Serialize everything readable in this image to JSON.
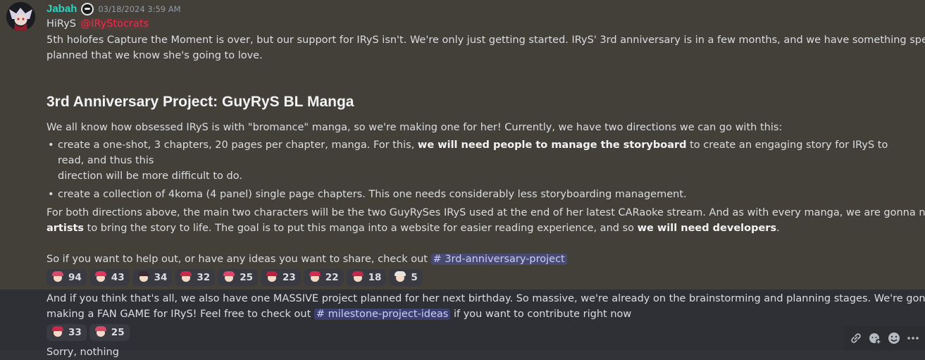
{
  "message1": {
    "username": "Jabah",
    "timestamp": "03/18/2024 3:59 AM",
    "greeting": "HiRyS",
    "mention": "@IRyStocrats",
    "intro": "5th holofes Capture the Moment is over, but our support for IRyS isn't. We're only just getting started. IRyS' 3rd anniversary is in a few months, and we have something special",
    "intro2": "planned that we know she's going to love.",
    "heading": "3rd Anniversary Project: GuyRyS BL Manga",
    "para1": "We all know how obsessed IRyS is with \"bromance\" manga, so we're making one for her! Currently, we have two directions we can go with this:",
    "bullet1_pre": "create a one-shot, 3 chapters, 20 pages per chapter, manga. For this, ",
    "bullet1_bold": "we will need people to manage the storyboard",
    "bullet1_post": " to create an engaging story for IRyS to read, and thus this",
    "bullet1_line2": "direction will be more difficult to do.",
    "bullet2": "create a collection of 4koma (4 panel) single page chapters. This one needs considerably less storyboarding management.",
    "para2_line1": "For both directions above, the main two characters will be the two GuyRySes IRyS used at the end of her latest CARaoke stream. And as with every manga, we are gonna need",
    "para2_bold1": "artists",
    "para2_mid": " to bring the story to life. The goal is to put this manga into a website for easier reading experience, and so ",
    "para2_bold2": "we will need developers",
    "para2_end": ".",
    "para3": "So if you want to help out, or have any ideas you want to share, check out ",
    "channel": "# 3rd-anniversary-project",
    "reactions": [
      {
        "count": "94",
        "hair": "#d94a6a",
        "icon": "reaction-emoji-1"
      },
      {
        "count": "43",
        "hair": "#e0365d",
        "icon": "reaction-emoji-2"
      },
      {
        "count": "34",
        "hair": "#3a2a33",
        "icon": "reaction-emoji-3"
      },
      {
        "count": "32",
        "hair": "#c82a4a",
        "icon": "reaction-emoji-4"
      },
      {
        "count": "25",
        "hair": "#e2446b",
        "icon": "reaction-emoji-5"
      },
      {
        "count": "23",
        "hair": "#b8223e",
        "icon": "reaction-emoji-6"
      },
      {
        "count": "22",
        "hair": "#d22d4f",
        "icon": "reaction-emoji-7"
      },
      {
        "count": "18",
        "hair": "#c5264a",
        "icon": "reaction-emoji-8"
      },
      {
        "count": "5",
        "hair": "#e9e3de",
        "icon": "reaction-emoji-9"
      }
    ]
  },
  "message2": {
    "line1": "And if you think that's all, we also have one MASSIVE project planned for her next birthday. So massive, we're already on the brainstorming and planning stages. We're gonna be",
    "line2_pre": "making a FAN GAME for IRyS! Feel free to check out ",
    "channel": "# milestone-project-ideas",
    "line2_post": " if you want to contribute right now",
    "reactions": [
      {
        "count": "33",
        "hair": "#c82a4a",
        "icon": "reaction-emoji-10"
      },
      {
        "count": "25",
        "hair": "#d94a6a",
        "icon": "reaction-emoji-11"
      }
    ],
    "cutoff": "Sorry, nothing"
  },
  "colors": {
    "username": "#2dd4bf",
    "mention": "#ef2b47",
    "highlight_bg": "#433f39",
    "background": "#313338"
  }
}
